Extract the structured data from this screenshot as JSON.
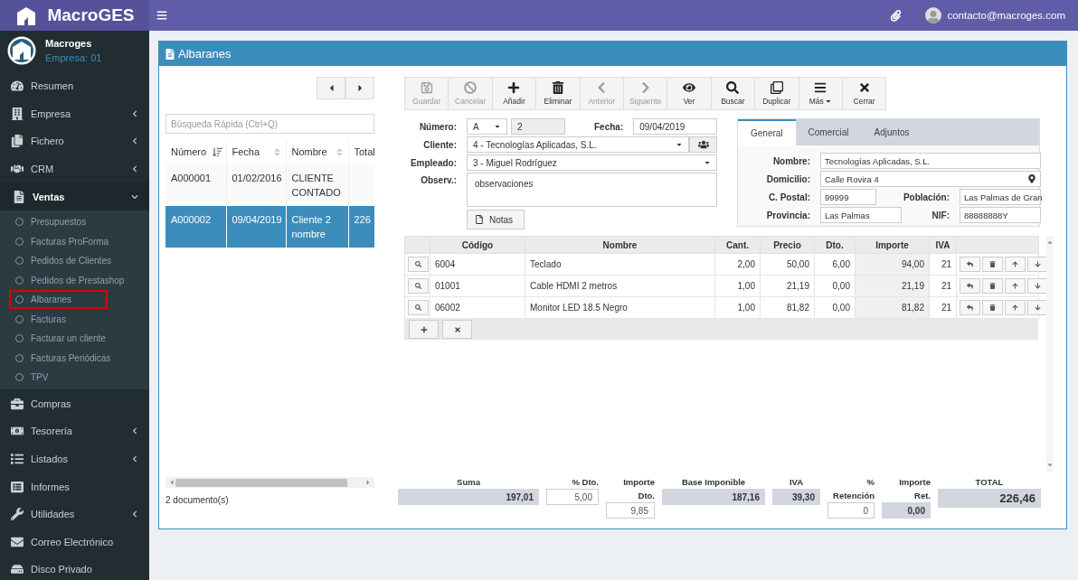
{
  "brand": {
    "name": "MacroGES"
  },
  "header": {
    "user_email": "contacto@macroges.com"
  },
  "user_panel": {
    "name": "Macroges",
    "company": "Empresa: 01"
  },
  "sidebar": {
    "items": [
      {
        "label": "Resumen",
        "kind": "link"
      },
      {
        "label": "Empresa",
        "kind": "menu",
        "expanded": false
      },
      {
        "label": "Fichero",
        "kind": "menu",
        "expanded": false
      },
      {
        "label": "CRM",
        "kind": "menu",
        "expanded": false
      },
      {
        "label": "Ventas",
        "kind": "menu",
        "expanded": true,
        "children": [
          {
            "label": "Presupuestos",
            "selected": false
          },
          {
            "label": "Facturas ProForma",
            "selected": false
          },
          {
            "label": "Pedidos de Clientes",
            "selected": false
          },
          {
            "label": "Pedidos de Prestashop",
            "selected": false
          },
          {
            "label": "Albaranes",
            "selected": true
          },
          {
            "label": "Facturas",
            "selected": false
          },
          {
            "label": "Facturar un cliente",
            "selected": false
          },
          {
            "label": "Facturas Periódicas",
            "selected": false
          },
          {
            "label": "TPV",
            "selected": false
          }
        ]
      },
      {
        "label": "Compras",
        "kind": "link"
      },
      {
        "label": "Tesorería",
        "kind": "menu",
        "expanded": false
      },
      {
        "label": "Listados",
        "kind": "menu",
        "expanded": false
      },
      {
        "label": "Informes",
        "kind": "link"
      },
      {
        "label": "Utilidades",
        "kind": "menu",
        "expanded": false
      },
      {
        "label": "Correo Electrónico",
        "kind": "link"
      },
      {
        "label": "Disco Privado",
        "kind": "link"
      }
    ]
  },
  "panel": {
    "title": "Albaranes"
  },
  "list": {
    "search": {
      "placeholder": "Búsqueda Rápida (Ctrl+Q)"
    },
    "columns": [
      {
        "label": "Número",
        "sorted": true
      },
      {
        "label": "Fecha",
        "sorted": false
      },
      {
        "label": "Nombre",
        "sorted": false
      },
      {
        "label": "Total"
      }
    ],
    "rows": [
      {
        "cells": [
          "A000001",
          "01/02/2016",
          "CLIENTE CONTADO",
          ""
        ],
        "selected": false
      },
      {
        "cells": [
          "A000002",
          "09/04/2019",
          "Cliente 2 nombre",
          "226"
        ],
        "selected": true
      }
    ],
    "count": "2 documento(s)"
  },
  "toolbar": [
    {
      "label": "Guardar",
      "kind": "button",
      "disabled": true
    },
    {
      "label": "Cancelar",
      "kind": "button",
      "disabled": true
    },
    {
      "label": "Añadir",
      "kind": "button",
      "disabled": false
    },
    {
      "label": "Eliminar",
      "kind": "button",
      "disabled": false
    },
    {
      "label": "Anterior",
      "kind": "button",
      "disabled": true
    },
    {
      "label": "Siguiente",
      "kind": "button",
      "disabled": true
    },
    {
      "label": "Ver",
      "kind": "button",
      "disabled": false
    },
    {
      "label": "Buscar",
      "kind": "button",
      "disabled": false
    },
    {
      "label": "Duplicar",
      "kind": "button",
      "disabled": false
    },
    {
      "label": "Más",
      "kind": "dropdown",
      "disabled": false
    },
    {
      "label": "Cerrar",
      "kind": "button",
      "disabled": false
    }
  ],
  "form": {
    "numero_label": "Número:",
    "serie": "A",
    "numero": "2",
    "fecha_label": "Fecha:",
    "fecha": "09/04/2019",
    "cliente_label": "Cliente:",
    "cliente": "4 - Tecnologías Aplicadas, S.L.",
    "empleado_label": "Empleado:",
    "empleado": "3 - Miguel Rodríguez",
    "observ_label": "Observ.:",
    "observ": "observaciones",
    "notes_button": "Notas"
  },
  "client_tabs": [
    {
      "label": "General",
      "selected": true
    },
    {
      "label": "Comercial",
      "selected": false
    },
    {
      "label": "Adjuntos",
      "selected": false
    }
  ],
  "client": {
    "nombre_label": "Nombre:",
    "nombre": "Tecnologías Aplicadas, S.L.",
    "domicilio_label": "Domicilio:",
    "domicilio": "Calle Rovira 4",
    "cpostal_label": "C. Postal:",
    "cpostal": "99999",
    "poblacion_label": "Población:",
    "poblacion": "Las Palmas de Gran",
    "provincia_label": "Provincia:",
    "provincia": "Las Palmas",
    "nif_label": "NIF:",
    "nif": "88888888Y"
  },
  "lines": {
    "columns": [
      "Código",
      "Nombre",
      "Cant.",
      "Precio",
      "Dto.",
      "Importe",
      "IVA"
    ],
    "rows": [
      [
        "6004",
        "Teclado",
        "2,00",
        "50,00",
        "6,00",
        "94,00",
        "21"
      ],
      [
        "01001",
        "Cable HDMI 2 metros",
        "1,00",
        "21,19",
        "0,00",
        "21,19",
        "21"
      ],
      [
        "06002",
        "Monitor LED 18.5 Negro",
        "1,00",
        "81,82",
        "0,00",
        "81,82",
        "21"
      ]
    ]
  },
  "totals": [
    {
      "label": "Suma",
      "value": "197,01",
      "kind": "readonly"
    },
    {
      "label": "% Dto.",
      "value": "5,00",
      "kind": "input"
    },
    {
      "label": "Importe Dto.",
      "value": "9,85",
      "kind": "input"
    },
    {
      "label": "Base Imponible",
      "value": "187,16",
      "kind": "readonly"
    },
    {
      "label": "IVA",
      "value": "39,30",
      "kind": "readonly"
    },
    {
      "label": "% Retención",
      "value": "0",
      "kind": "input"
    },
    {
      "label": "Importe Ret.",
      "value": "0,00",
      "kind": "readonly"
    },
    {
      "label": "TOTAL",
      "value": "226,46",
      "kind": "total"
    }
  ]
}
